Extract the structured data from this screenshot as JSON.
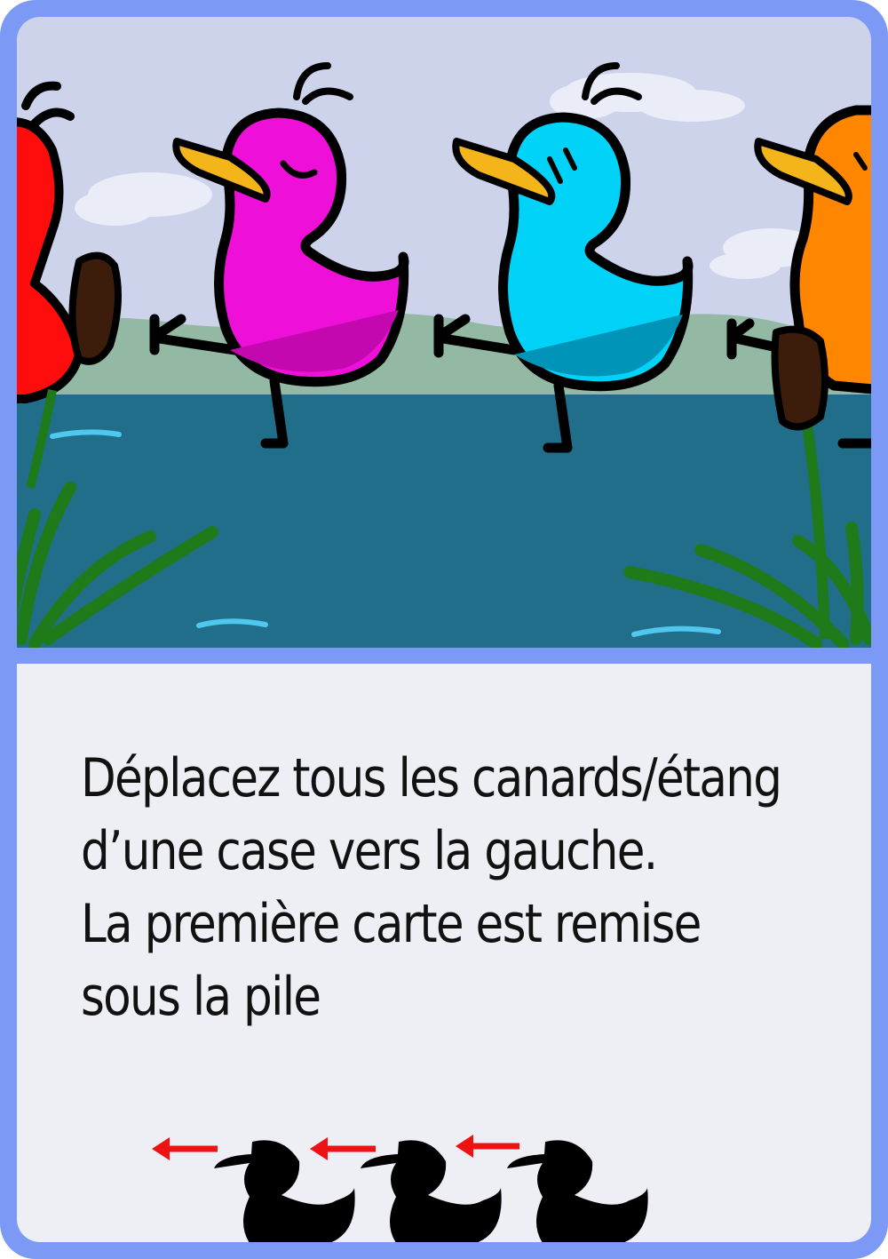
{
  "card": {
    "text_lines": [
      "Déplacez tous les canards/étang",
      "d’une case vers la gauche.",
      "La première carte est remise",
      "sous la pile"
    ]
  },
  "colors": {
    "border": "#7c99f6",
    "panel": "#eeeff5",
    "sky": "#ced3ec",
    "water": "#216e8a",
    "hills": "#93b9a5",
    "duck_red": "#ff0c0c",
    "duck_pink": "#ee10d8",
    "duck_blue": "#00d2f8",
    "duck_orange": "#ff8600",
    "beak": "#f4b51a",
    "cattail": "#3c1d0c",
    "grass": "#1f7a1a",
    "arrow": "#ee1212"
  },
  "icons": [
    "duck-silhouette-icon",
    "left-arrow-icon"
  ]
}
